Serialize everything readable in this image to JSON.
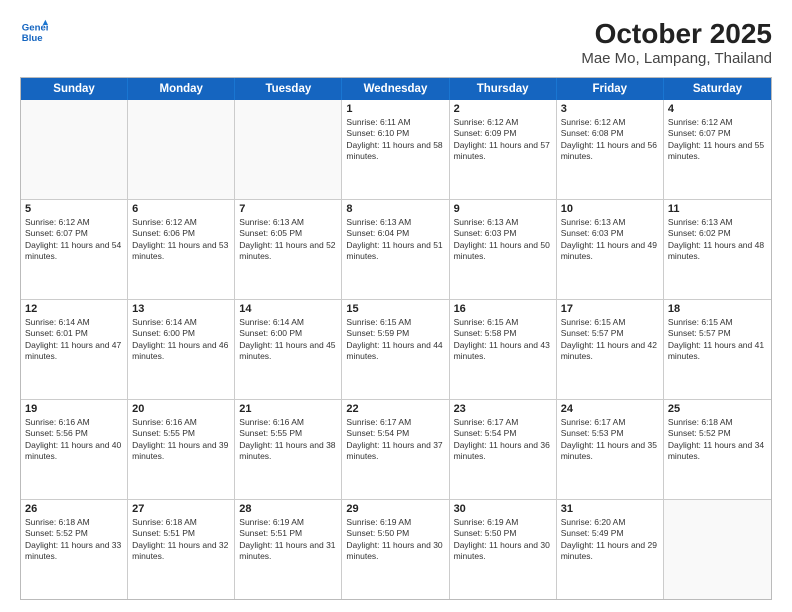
{
  "logo": {
    "line1": "General",
    "line2": "Blue"
  },
  "title": "October 2025",
  "subtitle": "Mae Mo, Lampang, Thailand",
  "header_days": [
    "Sunday",
    "Monday",
    "Tuesday",
    "Wednesday",
    "Thursday",
    "Friday",
    "Saturday"
  ],
  "weeks": [
    [
      {
        "day": "",
        "empty": true
      },
      {
        "day": "",
        "empty": true
      },
      {
        "day": "",
        "empty": true
      },
      {
        "day": "1",
        "sunrise": "6:11 AM",
        "sunset": "6:10 PM",
        "daylight": "11 hours and 58 minutes."
      },
      {
        "day": "2",
        "sunrise": "6:12 AM",
        "sunset": "6:09 PM",
        "daylight": "11 hours and 57 minutes."
      },
      {
        "day": "3",
        "sunrise": "6:12 AM",
        "sunset": "6:08 PM",
        "daylight": "11 hours and 56 minutes."
      },
      {
        "day": "4",
        "sunrise": "6:12 AM",
        "sunset": "6:07 PM",
        "daylight": "11 hours and 55 minutes."
      }
    ],
    [
      {
        "day": "5",
        "sunrise": "6:12 AM",
        "sunset": "6:07 PM",
        "daylight": "11 hours and 54 minutes."
      },
      {
        "day": "6",
        "sunrise": "6:12 AM",
        "sunset": "6:06 PM",
        "daylight": "11 hours and 53 minutes."
      },
      {
        "day": "7",
        "sunrise": "6:13 AM",
        "sunset": "6:05 PM",
        "daylight": "11 hours and 52 minutes."
      },
      {
        "day": "8",
        "sunrise": "6:13 AM",
        "sunset": "6:04 PM",
        "daylight": "11 hours and 51 minutes."
      },
      {
        "day": "9",
        "sunrise": "6:13 AM",
        "sunset": "6:03 PM",
        "daylight": "11 hours and 50 minutes."
      },
      {
        "day": "10",
        "sunrise": "6:13 AM",
        "sunset": "6:03 PM",
        "daylight": "11 hours and 49 minutes."
      },
      {
        "day": "11",
        "sunrise": "6:13 AM",
        "sunset": "6:02 PM",
        "daylight": "11 hours and 48 minutes."
      }
    ],
    [
      {
        "day": "12",
        "sunrise": "6:14 AM",
        "sunset": "6:01 PM",
        "daylight": "11 hours and 47 minutes."
      },
      {
        "day": "13",
        "sunrise": "6:14 AM",
        "sunset": "6:00 PM",
        "daylight": "11 hours and 46 minutes."
      },
      {
        "day": "14",
        "sunrise": "6:14 AM",
        "sunset": "6:00 PM",
        "daylight": "11 hours and 45 minutes."
      },
      {
        "day": "15",
        "sunrise": "6:15 AM",
        "sunset": "5:59 PM",
        "daylight": "11 hours and 44 minutes."
      },
      {
        "day": "16",
        "sunrise": "6:15 AM",
        "sunset": "5:58 PM",
        "daylight": "11 hours and 43 minutes."
      },
      {
        "day": "17",
        "sunrise": "6:15 AM",
        "sunset": "5:57 PM",
        "daylight": "11 hours and 42 minutes."
      },
      {
        "day": "18",
        "sunrise": "6:15 AM",
        "sunset": "5:57 PM",
        "daylight": "11 hours and 41 minutes."
      }
    ],
    [
      {
        "day": "19",
        "sunrise": "6:16 AM",
        "sunset": "5:56 PM",
        "daylight": "11 hours and 40 minutes."
      },
      {
        "day": "20",
        "sunrise": "6:16 AM",
        "sunset": "5:55 PM",
        "daylight": "11 hours and 39 minutes."
      },
      {
        "day": "21",
        "sunrise": "6:16 AM",
        "sunset": "5:55 PM",
        "daylight": "11 hours and 38 minutes."
      },
      {
        "day": "22",
        "sunrise": "6:17 AM",
        "sunset": "5:54 PM",
        "daylight": "11 hours and 37 minutes."
      },
      {
        "day": "23",
        "sunrise": "6:17 AM",
        "sunset": "5:54 PM",
        "daylight": "11 hours and 36 minutes."
      },
      {
        "day": "24",
        "sunrise": "6:17 AM",
        "sunset": "5:53 PM",
        "daylight": "11 hours and 35 minutes."
      },
      {
        "day": "25",
        "sunrise": "6:18 AM",
        "sunset": "5:52 PM",
        "daylight": "11 hours and 34 minutes."
      }
    ],
    [
      {
        "day": "26",
        "sunrise": "6:18 AM",
        "sunset": "5:52 PM",
        "daylight": "11 hours and 33 minutes."
      },
      {
        "day": "27",
        "sunrise": "6:18 AM",
        "sunset": "5:51 PM",
        "daylight": "11 hours and 32 minutes."
      },
      {
        "day": "28",
        "sunrise": "6:19 AM",
        "sunset": "5:51 PM",
        "daylight": "11 hours and 31 minutes."
      },
      {
        "day": "29",
        "sunrise": "6:19 AM",
        "sunset": "5:50 PM",
        "daylight": "11 hours and 30 minutes."
      },
      {
        "day": "30",
        "sunrise": "6:19 AM",
        "sunset": "5:50 PM",
        "daylight": "11 hours and 30 minutes."
      },
      {
        "day": "31",
        "sunrise": "6:20 AM",
        "sunset": "5:49 PM",
        "daylight": "11 hours and 29 minutes."
      },
      {
        "day": "",
        "empty": true
      }
    ]
  ]
}
